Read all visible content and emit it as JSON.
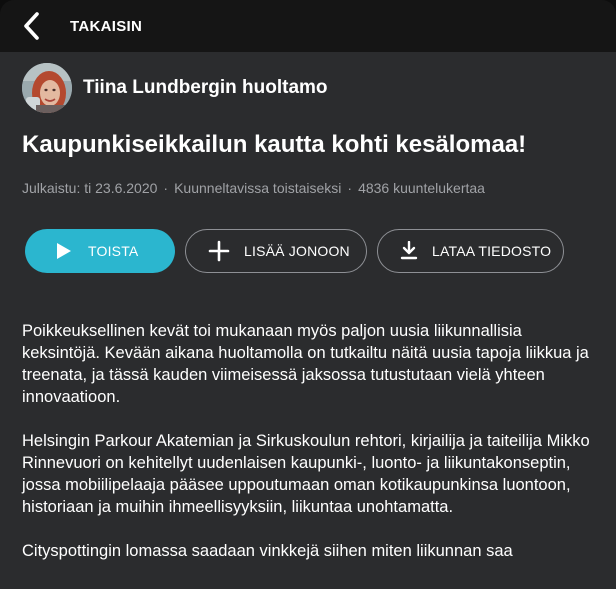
{
  "header": {
    "back_label": "TAKAISIN",
    "back_icon": "chevron-left-icon"
  },
  "channel": {
    "name": "Tiina Lundbergin huoltamo"
  },
  "episode": {
    "title": "Kaupunkiseikkailun kautta kohti kesälomaa!",
    "published": "Julkaistu: ti 23.6.2020",
    "availability": "Kuunneltavissa toistaiseksi",
    "listens": "4836 kuuntelukertaa"
  },
  "actions": {
    "play_label": "TOISTA",
    "queue_label": "LISÄÄ JONOON",
    "download_label": "LATAA TIEDOSTO"
  },
  "description": {
    "paragraphs": [
      "Poikkeuksellinen kevät toi mukanaan myös paljon uusia liikunnallisia keksintöjä. Kevään aikana huoltamolla on tutkailtu näitä uusia tapoja liikkua ja treenata, ja tässä kauden viimeisessä jaksossa tutustutaan vielä yhteen innovaatioon.",
      "Helsingin Parkour Akatemian ja Sirkuskoulun rehtori, kirjailija ja taiteilija Mikko Rinnevuori on kehitellyt uudenlaisen kaupunki-, luonto- ja liikuntakonseptin, jossa mobiilipelaaja pääsee uppoutumaan oman kotikaupunkinsa luontoon, historiaan ja muihin ihmeellisyyksiin, liikuntaa unohtamatta.",
      "Cityspottingin lomassa saadaan vinkkejä siihen miten liikunnan saa"
    ]
  },
  "colors": {
    "accent": "#2bb6cf",
    "background": "#2b2c2e",
    "topbar": "#151515",
    "meta_text": "#a0a2a6"
  }
}
